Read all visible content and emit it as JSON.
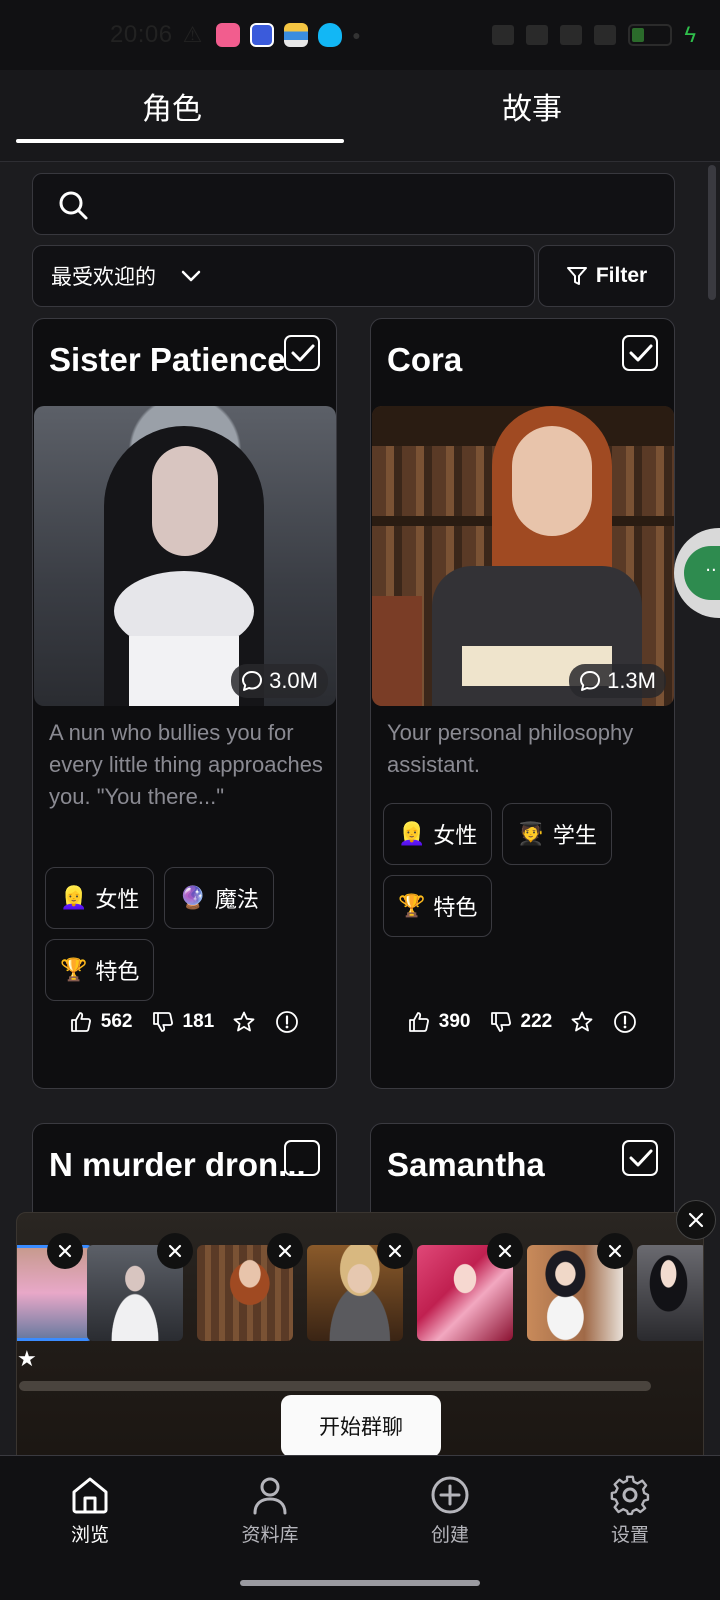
{
  "status_bar": {
    "time": "20:06",
    "notification_icons": [
      "bilibili-icon",
      "tieba-icon",
      "wallet-icon",
      "qq-icon"
    ],
    "battery_percent": 26
  },
  "tabs": [
    {
      "label": "角色",
      "active": true
    },
    {
      "label": "故事",
      "active": false
    }
  ],
  "search": {
    "placeholder": ""
  },
  "sort": {
    "label": "最受欢迎的"
  },
  "filter": {
    "label": "Filter"
  },
  "cards": [
    {
      "name": "Sister Patience",
      "checked": true,
      "chats": "3.0M",
      "description": "A nun who bullies you for every little thing approaches you. \"You there...\"",
      "tags": [
        {
          "emoji": "👱‍♀️",
          "label": "女性"
        },
        {
          "emoji": "🔮",
          "label": "魔法"
        },
        {
          "emoji": "🏆",
          "label": "特色"
        }
      ],
      "likes": "562",
      "dislikes": "181"
    },
    {
      "name": "Cora",
      "checked": true,
      "chats": "1.3M",
      "description": "Your personal philosophy assistant.",
      "tags": [
        {
          "emoji": "👱‍♀️",
          "label": "女性"
        },
        {
          "emoji": "🧑‍🎓",
          "label": "学生"
        },
        {
          "emoji": "🏆",
          "label": "特色"
        }
      ],
      "likes": "390",
      "dislikes": "222"
    },
    {
      "name": "N murder dron...",
      "checked": false
    },
    {
      "name": "Samantha",
      "checked": true
    }
  ],
  "tray": {
    "start_label": "开始群聊",
    "star": "★",
    "thumbnails": [
      "thumb-girl-pink",
      "thumb-sister-patience",
      "thumb-cora",
      "thumb-blonde",
      "thumb-anime-pink",
      "thumb-dark-hair",
      "thumb-dark-anime"
    ]
  },
  "bottom_nav": [
    {
      "label": "浏览",
      "icon": "home-icon",
      "active": true
    },
    {
      "label": "资料库",
      "icon": "person-icon",
      "active": false
    },
    {
      "label": "创建",
      "icon": "plus-circle-icon",
      "active": false
    },
    {
      "label": "设置",
      "icon": "gear-icon",
      "active": false
    }
  ],
  "floating_bubble": {
    "label": "··"
  }
}
